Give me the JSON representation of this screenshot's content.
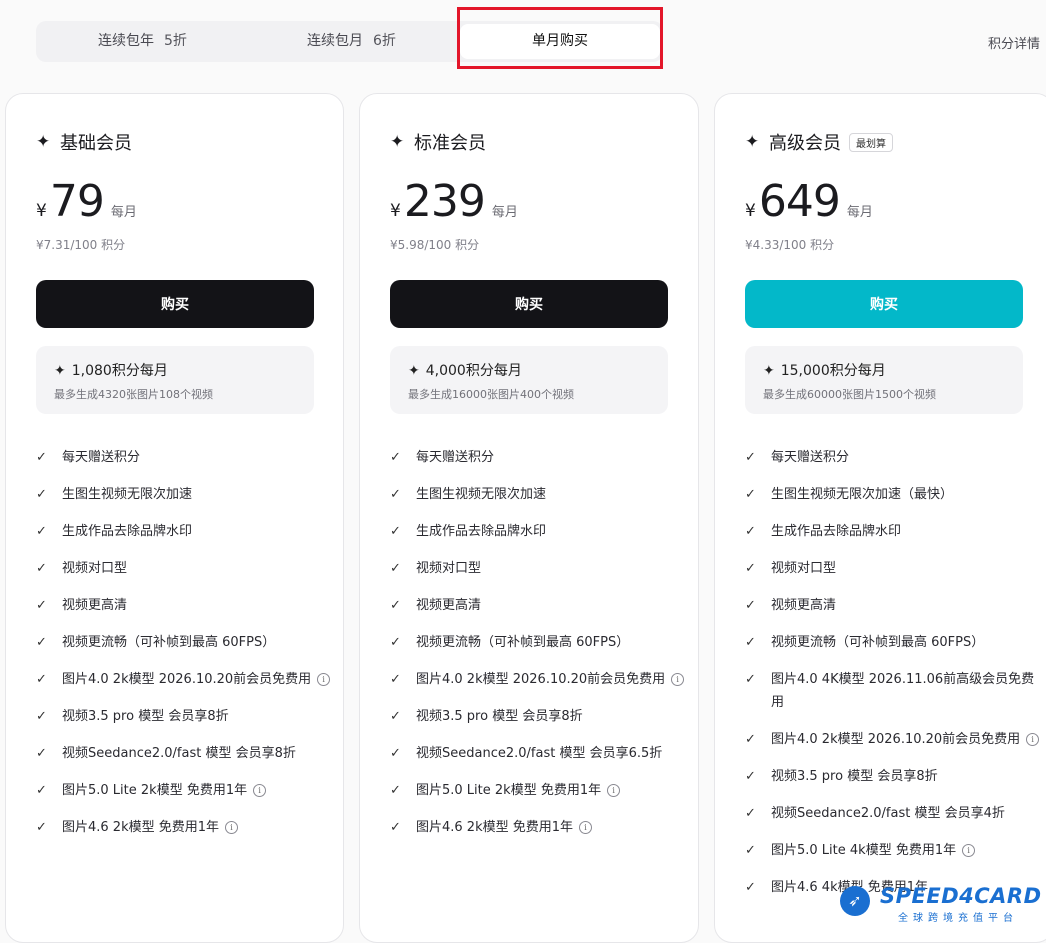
{
  "tabs": [
    {
      "label": "连续包年",
      "discount": "5折"
    },
    {
      "label": "连续包月",
      "discount": "6折"
    },
    {
      "label": "单月购买"
    }
  ],
  "points_detail_link": "积分详情",
  "plans": [
    {
      "title": "基础会员",
      "badge": "",
      "currency": "¥",
      "price": "79",
      "period": "每月",
      "unit_price": "¥7.31/100 积分",
      "buy_label": "购买",
      "points": "1,080积分每月",
      "points_sub": "最多生成4320张图片108个视频",
      "features": [
        {
          "text": "每天赠送积分",
          "info": false
        },
        {
          "text": "生图生视频无限次加速",
          "info": false
        },
        {
          "text": "生成作品去除品牌水印",
          "info": false
        },
        {
          "text": "视频对口型",
          "info": false
        },
        {
          "text": "视频更高清",
          "info": false
        },
        {
          "text": "视频更流畅（可补帧到最高 60FPS）",
          "info": false
        },
        {
          "text": "图片4.0 2k模型 2026.10.20前会员免费用",
          "info": true
        },
        {
          "text": "视频3.5 pro 模型 会员享8折",
          "info": false
        },
        {
          "text": "视频Seedance2.0/fast 模型 会员享8折",
          "info": false
        },
        {
          "text": "图片5.0 Lite 2k模型 免费用1年",
          "info": true
        },
        {
          "text": "图片4.6 2k模型 免费用1年",
          "info": true
        }
      ]
    },
    {
      "title": "标准会员",
      "badge": "",
      "currency": "¥",
      "price": "239",
      "period": "每月",
      "unit_price": "¥5.98/100 积分",
      "buy_label": "购买",
      "points": "4,000积分每月",
      "points_sub": "最多生成16000张图片400个视频",
      "features": [
        {
          "text": "每天赠送积分",
          "info": false
        },
        {
          "text": "生图生视频无限次加速",
          "info": false
        },
        {
          "text": "生成作品去除品牌水印",
          "info": false
        },
        {
          "text": "视频对口型",
          "info": false
        },
        {
          "text": "视频更高清",
          "info": false
        },
        {
          "text": "视频更流畅（可补帧到最高 60FPS）",
          "info": false
        },
        {
          "text": "图片4.0 2k模型 2026.10.20前会员免费用",
          "info": true
        },
        {
          "text": "视频3.5 pro 模型 会员享8折",
          "info": false
        },
        {
          "text": "视频Seedance2.0/fast 模型 会员享6.5折",
          "info": false
        },
        {
          "text": "图片5.0 Lite 2k模型 免费用1年",
          "info": true
        },
        {
          "text": "图片4.6 2k模型 免费用1年",
          "info": true
        }
      ]
    },
    {
      "title": "高级会员",
      "badge": "最划算",
      "currency": "¥",
      "price": "649",
      "period": "每月",
      "unit_price": "¥4.33/100 积分",
      "buy_label": "购买",
      "points": "15,000积分每月",
      "points_sub": "最多生成60000张图片1500个视频",
      "features": [
        {
          "text": "每天赠送积分",
          "info": false
        },
        {
          "text": "生图生视频无限次加速（最快）",
          "info": false
        },
        {
          "text": "生成作品去除品牌水印",
          "info": false
        },
        {
          "text": "视频对口型",
          "info": false
        },
        {
          "text": "视频更高清",
          "info": false
        },
        {
          "text": "视频更流畅（可补帧到最高 60FPS）",
          "info": false
        },
        {
          "text": "图片4.0 4K模型 2026.11.06前高级会员免费用",
          "info": false
        },
        {
          "text": "图片4.0 2k模型 2026.10.20前会员免费用",
          "info": true
        },
        {
          "text": "视频3.5 pro 模型 会员享8折",
          "info": false
        },
        {
          "text": "视频Seedance2.0/fast 模型 会员享4折",
          "info": false
        },
        {
          "text": "图片5.0 Lite 4k模型 免费用1年",
          "info": true
        },
        {
          "text": "图片4.6 4k模型 免费用1年",
          "info": false
        }
      ]
    }
  ],
  "watermark": {
    "brand": "SPEED4CARD",
    "sub": "全球跨境充值平台"
  },
  "colors": {
    "buy_dark": "#131317",
    "buy_premium": "#03b8c9",
    "highlight": "#e3162a",
    "watermark": "#1a6fd1"
  }
}
